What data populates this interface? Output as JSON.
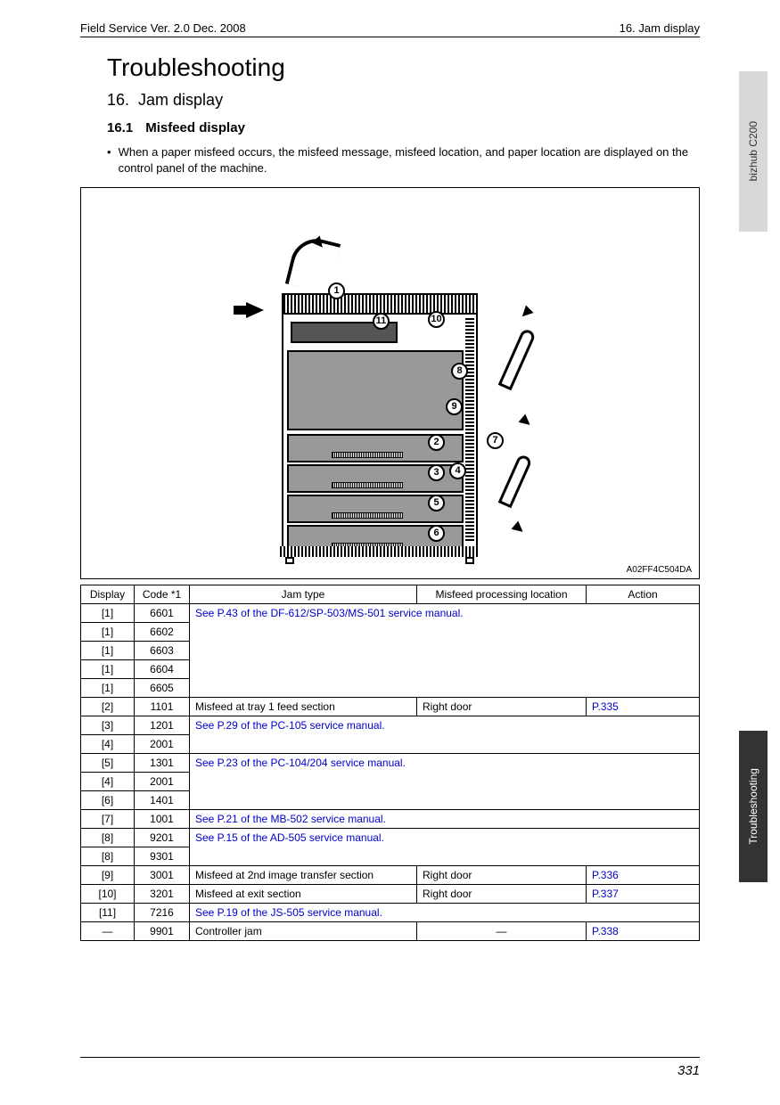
{
  "header": {
    "left": "Field Service Ver. 2.0 Dec. 2008",
    "right": "16. Jam display"
  },
  "tabs": {
    "top": "bizhub C200",
    "bottom": "Troubleshooting"
  },
  "title": "Troubleshooting",
  "section": {
    "num": "16.",
    "text": "Jam display"
  },
  "subsection": {
    "num": "16.1",
    "text": "Misfeed display"
  },
  "body_text": "When a paper misfeed occurs, the misfeed message, misfeed location, and paper location are displayed on the control panel of the machine.",
  "diagram_code": "A02FF4C504DA",
  "callouts": [
    "1",
    "2",
    "3",
    "4",
    "5",
    "6",
    "7",
    "8",
    "9",
    "10",
    "11"
  ],
  "table": {
    "headers": [
      "Display",
      "Code *1",
      "Jam type",
      "Misfeed processing location",
      "Action"
    ],
    "rows": [
      {
        "display": "[1]",
        "code": "6601",
        "span_text": "See P.43 of the DF-612/SP-503/MS-501 service manual.",
        "span_link": true,
        "span_rows": 5,
        "span_cols": 3
      },
      {
        "display": "[1]",
        "code": "6602"
      },
      {
        "display": "[1]",
        "code": "6603"
      },
      {
        "display": "[1]",
        "code": "6604"
      },
      {
        "display": "[1]",
        "code": "6605"
      },
      {
        "display": "[2]",
        "code": "1101",
        "jam": "Misfeed at tray 1 feed section",
        "loc": "Right door",
        "action": "P.335",
        "action_link": true
      },
      {
        "display": "[3]",
        "code": "1201",
        "span_text": "See P.29 of the PC-105 service manual.",
        "span_link": true,
        "span_rows": 2,
        "span_cols": 3
      },
      {
        "display": "[4]",
        "code": "2001"
      },
      {
        "display": "[5]",
        "code": "1301",
        "span_text": "See P.23 of the PC-104/204 service manual.",
        "span_link": true,
        "span_rows": 3,
        "span_cols": 3
      },
      {
        "display": "[4]",
        "code": "2001"
      },
      {
        "display": "[6]",
        "code": "1401"
      },
      {
        "display": "[7]",
        "code": "1001",
        "span_text": "See P.21 of the MB-502 service manual.",
        "span_link": true,
        "span_rows": 1,
        "span_cols": 3
      },
      {
        "display": "[8]",
        "code": "9201",
        "span_text": "See P.15 of the AD-505 service manual.",
        "span_link": true,
        "span_rows": 2,
        "span_cols": 3
      },
      {
        "display": "[8]",
        "code": "9301"
      },
      {
        "display": "[9]",
        "code": "3001",
        "jam": "Misfeed at 2nd image transfer section",
        "loc": "Right door",
        "action": "P.336",
        "action_link": true
      },
      {
        "display": "[10]",
        "code": "3201",
        "jam": "Misfeed at exit section",
        "loc": "Right door",
        "action": "P.337",
        "action_link": true
      },
      {
        "display": "[11]",
        "code": "7216",
        "span_text": "See P.19 of the JS-505 service manual.",
        "span_link": true,
        "span_rows": 1,
        "span_cols": 3
      },
      {
        "display": "—",
        "code": "9901",
        "jam": "Controller jam",
        "loc": "—",
        "loc_center": true,
        "action": "P.338",
        "action_link": true
      }
    ]
  },
  "page_number": "331"
}
